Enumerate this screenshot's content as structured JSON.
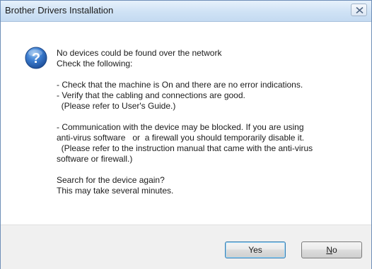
{
  "window": {
    "title": "Brother Drivers Installation",
    "close_icon": "close-x-icon"
  },
  "message": {
    "icon": "question-icon",
    "lines": [
      "No devices could be found over the network",
      "Check the following:",
      "",
      "- Check that the machine is On and there are no error indications.",
      "- Verify that the cabling and connections are good.",
      "  (Please refer to User's Guide.)",
      "",
      "- Communication with the device may be blocked. If you are using",
      "anti-virus software   or  a firewall you should temporarily disable it.",
      "  (Please refer to the instruction manual that came with the anti-virus",
      "software or firewall.)",
      "",
      "Search for the device again?",
      "This may take several minutes."
    ]
  },
  "buttons": {
    "yes_label": "Yes",
    "no_accel": "N",
    "no_rest": "o"
  },
  "colors": {
    "titlebar": "#cfe2f5",
    "footer": "#f0f0f0",
    "icon_blue": "#2a64b8"
  }
}
